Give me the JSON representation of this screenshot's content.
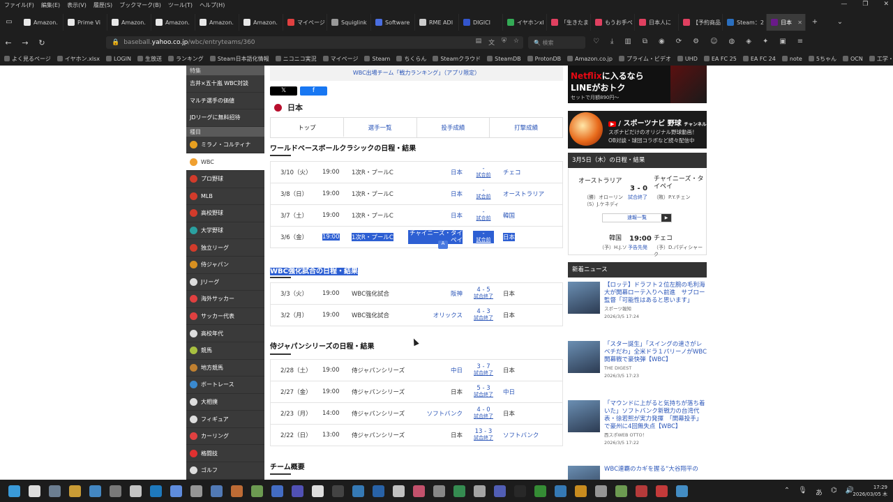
{
  "browser": {
    "menu": [
      "ファイル(F)",
      "編集(E)",
      "表示(V)",
      "履歴(S)",
      "ブックマーク(B)",
      "ツール(T)",
      "ヘルプ(H)"
    ],
    "tabs": [
      {
        "label": "Amazon.",
        "color": "#e8e8e8"
      },
      {
        "label": "Prime Vi",
        "color": "#e8e8e8"
      },
      {
        "label": "Amazon.",
        "color": "#e8e8e8"
      },
      {
        "label": "Amazon.",
        "color": "#e8e8e8"
      },
      {
        "label": "Amazon.",
        "color": "#e8e8e8"
      },
      {
        "label": "Amazon.",
        "color": "#e8e8e8"
      },
      {
        "label": "マイページ",
        "color": "#e04040"
      },
      {
        "label": "Squiglink",
        "color": "#999999"
      },
      {
        "label": "Software",
        "color": "#4a6ee0"
      },
      {
        "label": "RME ADI",
        "color": "#cccccc"
      },
      {
        "label": "DIGICI",
        "color": "#3355cc"
      },
      {
        "label": "イヤホンxl",
        "color": "#33aa55"
      },
      {
        "label": "「生きたま",
        "color": "#e04060"
      },
      {
        "label": "もうお手ペ",
        "color": "#e04060"
      },
      {
        "label": "日本人に",
        "color": "#e04060"
      },
      {
        "label": "【予約商品",
        "color": "#e04060"
      },
      {
        "label": "Steam：2",
        "color": "#2a6fbf"
      },
      {
        "label": "日本",
        "color": "#6a1a8a",
        "active": true
      }
    ],
    "url_prefix": "baseball.",
    "url_domain": "yahoo.co.jp",
    "url_path": "/wbc/entryteams/360",
    "search_placeholder": "検索",
    "bookmarks": [
      "よく見るページ",
      "イヤホン.xlsx",
      "LOGIN",
      "生放送",
      "ランキング",
      "Steam日本語化情報",
      "ニコニコ実況",
      "マイページ",
      "Steam",
      "ちくらん",
      "Steamクラウド",
      "SteamDB",
      "ProtonDB",
      "Amazon.co.jp",
      "プライム・ビデオ",
      "UHD",
      "EA FC 25",
      "EA FC 24",
      "note",
      "5ちゃん",
      "OCN",
      "工学・設備一覧 | NTT"
    ]
  },
  "sidebar": {
    "section1": "特集",
    "feature_items": [
      "吉井×五十嵐 WBC対談",
      "マルチ選手の価値",
      "JDリーグに無料招待"
    ],
    "section2": "種目",
    "sports": [
      {
        "label": "ミラノ・コルティナ",
        "color": "#e8a020",
        "active": false
      },
      {
        "label": "WBC",
        "color": "#f0a030",
        "active": true
      },
      {
        "label": "プロ野球",
        "color": "#d23b2b",
        "active": false
      },
      {
        "label": "MLB",
        "color": "#d23b2b",
        "active": false
      },
      {
        "label": "高校野球",
        "color": "#d23b2b",
        "active": false
      },
      {
        "label": "大学野球",
        "color": "#2aa0a0",
        "active": false
      },
      {
        "label": "独立リーグ",
        "color": "#d23b2b",
        "active": false
      },
      {
        "label": "侍ジャパン",
        "color": "#d89020",
        "active": false
      },
      {
        "label": "Jリーグ",
        "color": "#dddddd",
        "active": false
      },
      {
        "label": "海外サッカー",
        "color": "#e04040",
        "active": false
      },
      {
        "label": "サッカー代表",
        "color": "#e04040",
        "active": false
      },
      {
        "label": "高校年代",
        "color": "#dddddd",
        "active": false
      },
      {
        "label": "競馬",
        "color": "#a8c040",
        "active": false
      },
      {
        "label": "地方競馬",
        "color": "#c08030",
        "active": false
      },
      {
        "label": "ボートレース",
        "color": "#3a8ad0",
        "active": false
      },
      {
        "label": "大相撲",
        "color": "#dddddd",
        "active": false
      },
      {
        "label": "フィギュア",
        "color": "#dddddd",
        "active": false
      },
      {
        "label": "カーリング",
        "color": "#e04040",
        "active": false
      },
      {
        "label": "格闘技",
        "color": "#e03030",
        "active": false
      },
      {
        "label": "ゴルフ",
        "color": "#dddddd",
        "active": false
      }
    ]
  },
  "main": {
    "promo": "WBC出場チーム「戦力ランキング」（アプリ限定）",
    "share_x": "𝕏",
    "share_fb": "f",
    "team_name": "日本",
    "tabs": [
      "トップ",
      "選手一覧",
      "投手成績",
      "打撃成績"
    ],
    "wbc_title": "ワールドベースボールクラシックの日程・結果",
    "wbc_games": [
      {
        "date": "3/10（火）",
        "time": "19:00",
        "round": "1次R・プールC",
        "home": "日本",
        "status": "試合前",
        "away": "チェコ",
        "home_link": true,
        "away_link": true
      },
      {
        "date": "3/8（日）",
        "time": "19:00",
        "round": "1次R・プールC",
        "home": "日本",
        "status": "試合前",
        "away": "オーストラリア",
        "home_link": true,
        "away_link": true
      },
      {
        "date": "3/7（土）",
        "time": "19:00",
        "round": "1次R・プールC",
        "home": "日本",
        "status": "試合前",
        "away": "韓国",
        "home_link": true,
        "away_link": true
      },
      {
        "date": "3/6（金）",
        "time": "19:00",
        "round": "1次R・プールC",
        "home": "チャイニーズ・タイペイ",
        "status": "試合前",
        "away": "日本",
        "home_link": true,
        "away_link": true,
        "highlight": true
      }
    ],
    "exhibition_title": "WBC強化試合の日程・結果",
    "exhibition_games": [
      {
        "date": "3/3（火）",
        "time": "19:00",
        "round": "WBC強化試合",
        "home": "阪神",
        "score": "4 - 5",
        "status": "試合終了",
        "away": "日本"
      },
      {
        "date": "3/2（月）",
        "time": "19:00",
        "round": "WBC強化試合",
        "home": "オリックス",
        "score": "4 - 3",
        "status": "試合終了",
        "away": "日本"
      }
    ],
    "series_title": "侍ジャパンシリーズの日程・結果",
    "series_games": [
      {
        "date": "2/28（土）",
        "time": "19:00",
        "round": "侍ジャパンシリーズ",
        "home": "中日",
        "score": "3 - 7",
        "status": "試合終了",
        "away": "日本"
      },
      {
        "date": "2/27（金）",
        "time": "19:00",
        "round": "侍ジャパンシリーズ",
        "home": "日本",
        "score": "5 - 3",
        "status": "試合終了",
        "away": "中日"
      },
      {
        "date": "2/23（月）",
        "time": "14:00",
        "round": "侍ジャパンシリーズ",
        "home": "ソフトバンク",
        "score": "4 - 0",
        "status": "試合終了",
        "away": "日本"
      },
      {
        "date": "2/22（日）",
        "time": "13:00",
        "round": "侍ジャパンシリーズ",
        "home": "日本",
        "score": "13 - 3",
        "status": "試合終了",
        "away": "ソフトバンク"
      }
    ],
    "overview_title": "チーム概要"
  },
  "right": {
    "ad1": {
      "netflix": "Netflix",
      "line1_rest": "に入るなら",
      "line2": "LINEがおトク",
      "line3": "セットで月額890円〜"
    },
    "ad2": {
      "yt": "▶",
      "title": "/ スポーツナビ 野球",
      "channel": "チャンネル",
      "line1": "スポナビだけのオリジナル野球動画！",
      "line2": "OB対談・球団コラボなど続々配信中"
    },
    "schedule_title": "3月5日（木）の日程・結果",
    "game1": {
      "home": "オーストラリア",
      "away": "チャイニーズ・タイペイ",
      "score": "3 - 0",
      "status": "試合終了",
      "home_p1": "（勝）オローリン",
      "home_p2": "（S）J.ケネディ",
      "away_p1": "（敗）P.Y.チェン",
      "flash": "速報一覧"
    },
    "game2": {
      "home": "韓国",
      "away": "チェコ",
      "time": "19:00",
      "status": "予告先発",
      "home_p": "（予）H.J.ソ",
      "away_p": "（予）D.パディシャーク"
    },
    "news_title": "新着ニュース",
    "news": [
      {
        "text": "【ロッテ】ドラフト２位左腕の毛利海大が開幕ローテ入りへ前進　サブロー監督「可能性はあると思います」",
        "source": "スポーツ報知",
        "time": "2026/3/5 17:24"
      },
      {
        "text": "「スター誕生」「スイングの速さがレベチだわ」全米ドラ１パリーノがWBC開幕戦で豪快弾【WBC】",
        "source": "THE DIGEST",
        "time": "2026/3/5 17:23"
      },
      {
        "text": "「マウンドに上がると気持ちが落ち着いた」ソフトバンク新戦力の台湾代表・徐若熙が実力発揮　「開幕投手」で豪州に4回無失点【WBC】",
        "source": "西スポWEB OTTO！",
        "time": "2026/3/5 17:22"
      },
      {
        "text": "WBC連覇のカギを握る“大谷翔平の",
        "source": "",
        "time": ""
      }
    ]
  },
  "taskbar": {
    "time": "17:29",
    "date": "2026/03/05 木",
    "ime": "あ",
    "icons": [
      "#3a9ad9",
      "#ffffff",
      "#7a8fa6",
      "#e8b23a",
      "#4a9ae0",
      "#8a8a8a",
      "#e0e0e0",
      "#1f8ad9",
      "#6aa0ff",
      "#aaaaaa",
      "#5a8ad0",
      "#d9793a",
      "#7ab05a",
      "#4a7ae0",
      "#5a5ad0",
      "#ffffff",
      "#4a4a4a",
      "#3a8ad0",
      "#2a6fbf",
      "#dddddd",
      "#e05a7a",
      "#9a9a9a",
      "#3aa05a",
      "#bbbbbb",
      "#5a6ad0",
      "#2a2a2a",
      "#3aa03a",
      "#3a8ad0",
      "#e8a020",
      "#aaaaaa",
      "#7ab05a",
      "#d04040",
      "#e04040",
      "#4aa0e0"
    ]
  }
}
